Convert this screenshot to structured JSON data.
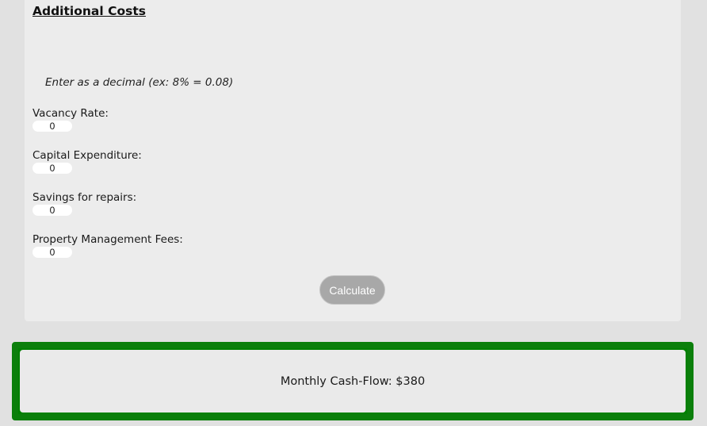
{
  "section": {
    "title": "Additional Costs",
    "hint": "Enter as a decimal (ex: 8% = 0.08)"
  },
  "fields": [
    {
      "label": "Vacancy Rate:",
      "value": "0"
    },
    {
      "label": "Capital Expenditure:",
      "value": "0"
    },
    {
      "label": "Savings for repairs:",
      "value": "0"
    },
    {
      "label": "Property Management Fees:",
      "value": "0"
    }
  ],
  "calculate_label": "Calculate",
  "result": {
    "text": "Monthly Cash-Flow: $380"
  },
  "colors": {
    "result_border": "#0b7f0b",
    "button_bg": "#a8a8a8"
  }
}
